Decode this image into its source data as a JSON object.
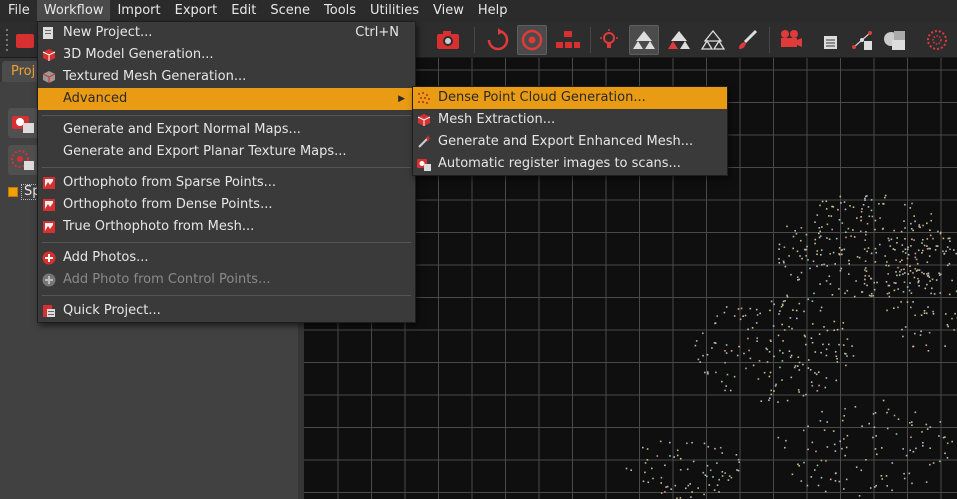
{
  "menubar": {
    "items": [
      "File",
      "Workflow",
      "Import",
      "Export",
      "Edit",
      "Scene",
      "Tools",
      "Utilities",
      "View",
      "Help"
    ],
    "active": "Workflow"
  },
  "left_panel": {
    "tab_label": "Proj",
    "tree_item_label": "Sp"
  },
  "workflow_menu": {
    "new_project": "New Project...",
    "new_project_shortcut": "Ctrl+N",
    "model_generation": "3D Model Generation...",
    "textured_mesh": "Textured Mesh Generation...",
    "advanced": "Advanced",
    "normal_maps": "Generate and Export Normal Maps...",
    "planar_texture": "Generate and Export Planar Texture Maps...",
    "ortho_sparse": "Orthophoto from Sparse Points...",
    "ortho_dense": "Orthophoto from Dense Points...",
    "true_ortho": "True Orthophoto from Mesh...",
    "add_photos": "Add Photos...",
    "add_photo_cp": "Add Photo from Control Points...",
    "quick_project": "Quick Project..."
  },
  "advanced_submenu": {
    "dense_cloud": "Dense Point Cloud Generation...",
    "mesh_extraction": "Mesh Extraction...",
    "enhanced_mesh": "Generate and Export Enhanced Mesh...",
    "auto_register": "Automatic register images to scans..."
  },
  "colors": {
    "accent": "#e99b13",
    "menu_bg": "#3a3a3a",
    "viewport_bg": "#0f0f0f",
    "grid": "#4a4a4a",
    "icon_red": "#e03a3a"
  }
}
